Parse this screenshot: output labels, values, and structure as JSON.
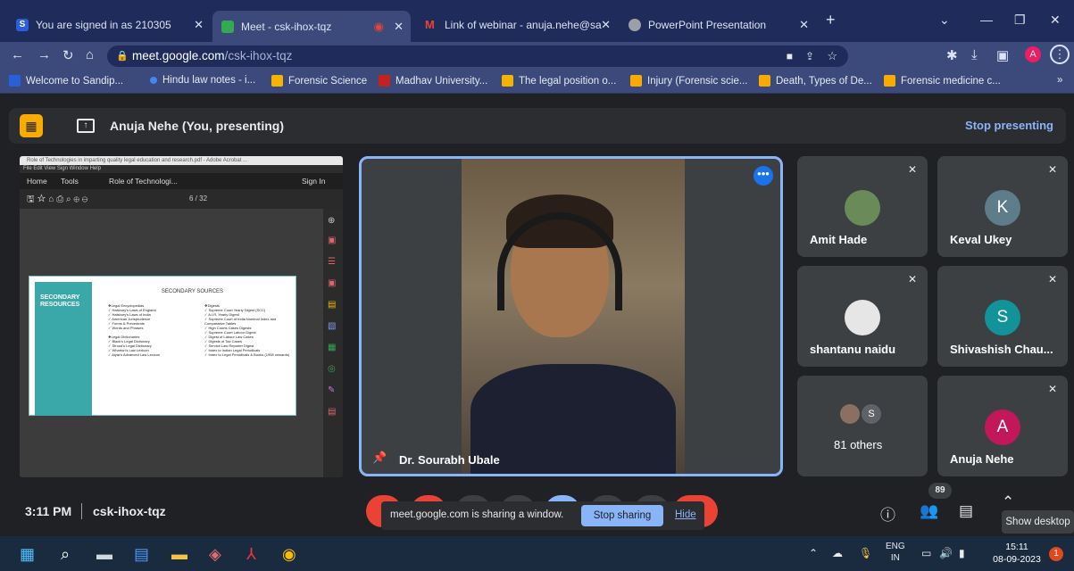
{
  "browser": {
    "tabs": [
      {
        "label": "You are signed in as 210305",
        "favicon_color": "#2b5fd9",
        "active": false
      },
      {
        "label": "Meet - csk-ihox-tqz",
        "favicon_color": "#34a853",
        "active": true
      },
      {
        "label": "Link of webinar - anuja.nehe@sa",
        "favicon_color": "#ea4335",
        "active": false
      },
      {
        "label": "PowerPoint Presentation",
        "favicon_color": "#9aa0a6",
        "active": false
      }
    ],
    "new_tab": "+",
    "url_host": "meet.google.com",
    "url_path": "/csk-ihox-tqz",
    "profile_initial": "A",
    "bookmarks": [
      {
        "label": "Welcome to Sandip...",
        "color": "#2b5fd9"
      },
      {
        "label": "Hindu law notes - i...",
        "color": "#4285f4"
      },
      {
        "label": "Forensic Science",
        "color": "#f4b400"
      },
      {
        "label": "Madhav University...",
        "color": "#c5221f"
      },
      {
        "label": "The legal position o...",
        "color": "#f4b400"
      },
      {
        "label": "Injury (Forensic scie...",
        "color": "#f9ab00"
      },
      {
        "label": "Death, Types of De...",
        "color": "#f9ab00"
      },
      {
        "label": "Forensic medicine c...",
        "color": "#f9ab00"
      }
    ],
    "bookmarks_more": "»"
  },
  "meet": {
    "presenting_label": "Anuja Nehe (You, presenting)",
    "stop_presenting": "Stop presenting",
    "pdf": {
      "title": "Role of Technologies in imparting quality legal education and research.pdf - Adobe Acrobat ...",
      "menu": "File   Edit   View   Sign   Window   Help",
      "home_tab": "Home",
      "tools_tab": "Tools",
      "doc_tab": "Role of Technologi...",
      "sign_in": "Sign In",
      "page_indicator": "6 / 32",
      "slide": {
        "band_title": "SECONDARY RESOURCES",
        "heading": "SECONDARY SOURCES",
        "col1": "❖Legal Encyclopedias\n  ✓ Halsbury's Laws of England\n  ✓ Halsbury's Laws of India\n  ✓ American Jurisprudence\n  ✓ Forms & Precedents\n  ✓ Words and Phrases\n\n❖Legal Dictionaries\n  ✓ Black's Legal Dictionary\n  ✓ Stroud's Legal Dictionary\n  ✓ Wharton's Law Lexicon\n  ✓ Aiyar's Advanced Law Lexicon",
        "col2": "❖Digests\n  ✓ Supreme Court Yearly Digest (SCC)\n  ✓ A.I.R. Yearly Digest\n  ✓ Supreme Court of India Nominal Index and Comparative Tables\n  ✓ High Courts Cases Digests\n  ✓ Supreme Court Labour Digest\n  ✓ Digest of Labour Law Cases\n  ✓ Digests of Tax Cases\n  ✓ Service Law Reporter Digest\n  ✓ Index to Indian Legal Periodicals\n  ✓ Index to Legal Periodicals & Books (1908 onwards)"
      }
    },
    "speaker_name": "Dr. Sourabh Ubale",
    "participants": [
      {
        "name": "Amit Hade",
        "initial": "",
        "color": "#6a8a5a"
      },
      {
        "name": "Keval Ukey",
        "initial": "K",
        "color": "#5f7c8a"
      },
      {
        "name": "shantanu naidu",
        "initial": "",
        "color": "#d9d9d9"
      },
      {
        "name": "Shivashish Chau...",
        "initial": "S",
        "color": "#12939a"
      },
      {
        "name": "81 others",
        "initial": "S",
        "color": "#5f6368"
      },
      {
        "name": "Anuja Nehe",
        "initial": "A",
        "color": "#c2185b"
      }
    ],
    "time": "3:11 PM",
    "meeting_code": "csk-ihox-tqz",
    "sharing_msg": "meet.google.com is sharing a window.",
    "stop_sharing": "Stop sharing",
    "hide": "Hide",
    "people_count": "89",
    "tooltip": "Show desktop"
  },
  "taskbar": {
    "lang_top": "ENG",
    "lang_bottom": "IN",
    "clock_time": "15:11",
    "clock_date": "08-09-2023",
    "notifications": "1"
  }
}
